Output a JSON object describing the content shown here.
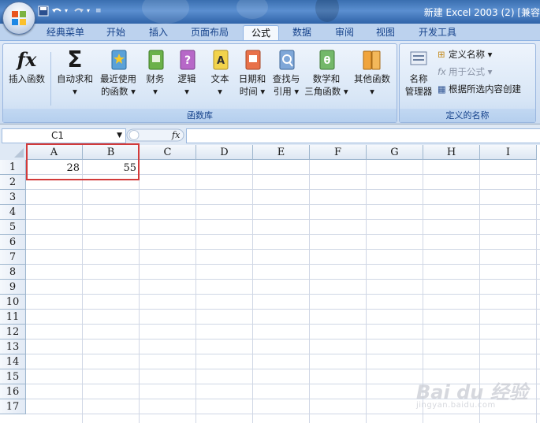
{
  "window": {
    "title": "新建 Excel 2003 (2)  [兼容"
  },
  "tabs": [
    "经典菜单",
    "开始",
    "插入",
    "页面布局",
    "公式",
    "数据",
    "审阅",
    "视图",
    "开发工具"
  ],
  "active_tab": "公式",
  "ribbon": {
    "function_library": {
      "label": "函数库",
      "insert_function": "插入函数",
      "autosum": {
        "line1": "自动求和",
        "line2": "▾"
      },
      "recent": {
        "line1": "最近使用",
        "line2": "的函数 ▾"
      },
      "financial": {
        "line1": "财务",
        "line2": "▾"
      },
      "logical": {
        "line1": "逻辑",
        "line2": "▾"
      },
      "text": {
        "line1": "文本",
        "line2": "▾"
      },
      "datetime": {
        "line1": "日期和",
        "line2": "时间 ▾"
      },
      "lookup": {
        "line1": "查找与",
        "line2": "引用 ▾"
      },
      "math": {
        "line1": "数学和",
        "line2": "三角函数 ▾"
      },
      "more": {
        "line1": "其他函数",
        "line2": "▾"
      }
    },
    "defined_names": {
      "label": "定义的名称",
      "name_manager": {
        "line1": "名称",
        "line2": "管理器"
      },
      "define_name": "定义名称 ▾",
      "use_in_formula": "用于公式 ▾",
      "create_from_selection": "根据所选内容创建"
    }
  },
  "formula_bar": {
    "name_box": "C1",
    "fx": "fx",
    "formula": ""
  },
  "columns": [
    "A",
    "B",
    "C",
    "D",
    "E",
    "F",
    "G",
    "H",
    "I"
  ],
  "rows": [
    "1",
    "2",
    "3",
    "4",
    "5",
    "6",
    "7",
    "8",
    "9",
    "10",
    "11",
    "12",
    "13",
    "14",
    "15",
    "16",
    "17"
  ],
  "cells": {
    "A1": "28",
    "B1": "55"
  },
  "watermark": {
    "main": "Bai du 经验",
    "sub": "jingyan.baidu.com"
  },
  "colors": {
    "accent": "#d23a3a",
    "ribbon": "#d8e6f6",
    "title": "#3a6fb0"
  }
}
